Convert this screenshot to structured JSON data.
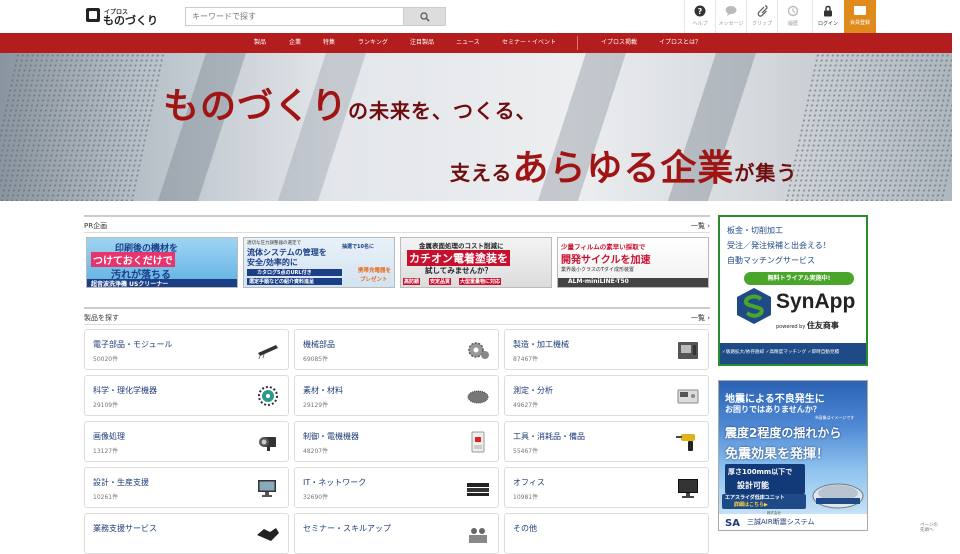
{
  "header": {
    "logo_small": "イプロス",
    "logo_main": "ものづくり",
    "search_placeholder": "キーワードで探す",
    "utilities": [
      {
        "label": "ヘルプ",
        "icon": "help-icon"
      },
      {
        "label": "メッセージ",
        "icon": "message-icon"
      },
      {
        "label": "クリップ",
        "icon": "clip-icon"
      },
      {
        "label": "履歴",
        "icon": "history-icon"
      },
      {
        "label": "ログイン",
        "icon": "lock-icon"
      }
    ],
    "member": {
      "label": "会員登録",
      "icon": "member-card-icon",
      "color": "#e08a1e"
    }
  },
  "nav": {
    "color": "#b41d1d",
    "items": [
      "製品",
      "企業",
      "特集",
      "ランキング",
      "注目製品",
      "ニュース",
      "セミナー・イベント",
      "イプロス掲載",
      "イプロスとは？"
    ]
  },
  "hero": {
    "line1_big": "ものづくり",
    "line1_small": "の未来を、つくる、",
    "line2_a": "支える",
    "line2_b": "あらゆる企業",
    "line2_c": "が集う"
  },
  "pr": {
    "title": "PR企画",
    "more": "一覧",
    "banners": [
      {
        "lines": [
          "印刷後の機材を",
          "つけておくだけで",
          "汚れが落ちる",
          "超音波洗浄機 USクリーナー"
        ]
      },
      {
        "lines": [
          "適切な圧力調整器の選定で",
          "流体システムの管理を",
          "安全/効率的に",
          "カタログ5点のURL付き",
          "選定手順などの紹介資料進呈",
          "抽選で10名に",
          "携帯充電器を",
          "プレゼント"
        ]
      },
      {
        "lines": [
          "金属表面処理のコスト削減に",
          "カチオン電着塗装を",
          "試してみませんか？",
          "高防錆",
          "安定品質",
          "大型重量物に対応"
        ]
      },
      {
        "lines": [
          "少量フィルムの素早い採取で",
          "開発サイクルを加速",
          "業界最小クラスのTダイ成形装置",
          "ALM-miniLINE-T50"
        ]
      }
    ]
  },
  "products": {
    "title": "製品を探す",
    "more": "一覧",
    "categories": [
      {
        "name": "電子部品・モジュール",
        "count": "50020件",
        "icon": "electronic-part-icon"
      },
      {
        "name": "機械部品",
        "count": "69085件",
        "icon": "gear-parts-icon"
      },
      {
        "name": "製造・加工機械",
        "count": "87467件",
        "icon": "machine-tool-icon"
      },
      {
        "name": "科学・理化学機器",
        "count": "29109件",
        "icon": "lab-equipment-icon"
      },
      {
        "name": "素材・材料",
        "count": "29129件",
        "icon": "material-icon"
      },
      {
        "name": "測定・分析",
        "count": "49627件",
        "icon": "measurement-icon"
      },
      {
        "name": "画像処理",
        "count": "13127件",
        "icon": "camera-icon"
      },
      {
        "name": "制御・電機機器",
        "count": "48207件",
        "icon": "breaker-icon"
      },
      {
        "name": "工具・消耗品・備品",
        "count": "55467件",
        "icon": "drill-icon"
      },
      {
        "name": "設計・生産支援",
        "count": "10261件",
        "icon": "monitor-icon"
      },
      {
        "name": "IT・ネットワーク",
        "count": "32690件",
        "icon": "server-icon"
      },
      {
        "name": "オフィス",
        "count": "10981件",
        "icon": "display-icon"
      },
      {
        "name": "業務支援サービス",
        "count": "",
        "icon": "handshake-icon"
      },
      {
        "name": "セミナー・スキルアップ",
        "count": "",
        "icon": "seminar-icon"
      },
      {
        "name": "その他",
        "count": "",
        "icon": ""
      }
    ]
  },
  "ad_synapp": {
    "lines": [
      "板金・切削加工",
      "受注／発注候補と出会える！",
      "自動マッチングサービス"
    ],
    "trial": "無料トライアル実施中!",
    "brand": "SynApp",
    "powered": "powered by",
    "company": "住友商事",
    "footer": "✓販路拡大/依存脱却 ✓高精度マッチング ✓即時自動見積"
  },
  "ad_quake": {
    "l1": "地震による不良発生に",
    "l2": "お困りではありませんか？",
    "l3": "震度2程度の揺れから",
    "l4": "免震効果を発揮！",
    "note": "※画像はイメージです",
    "l5": "厚さ100mm以下で",
    "l6": "設計可能",
    "l7": "エアスライダ低床ユニット",
    "l8": "詳細はこちら▶",
    "company_small": "株式会社",
    "company": "三誠AIR断震システム"
  },
  "scroll_hint": [
    "ページの",
    "先頭へ"
  ]
}
